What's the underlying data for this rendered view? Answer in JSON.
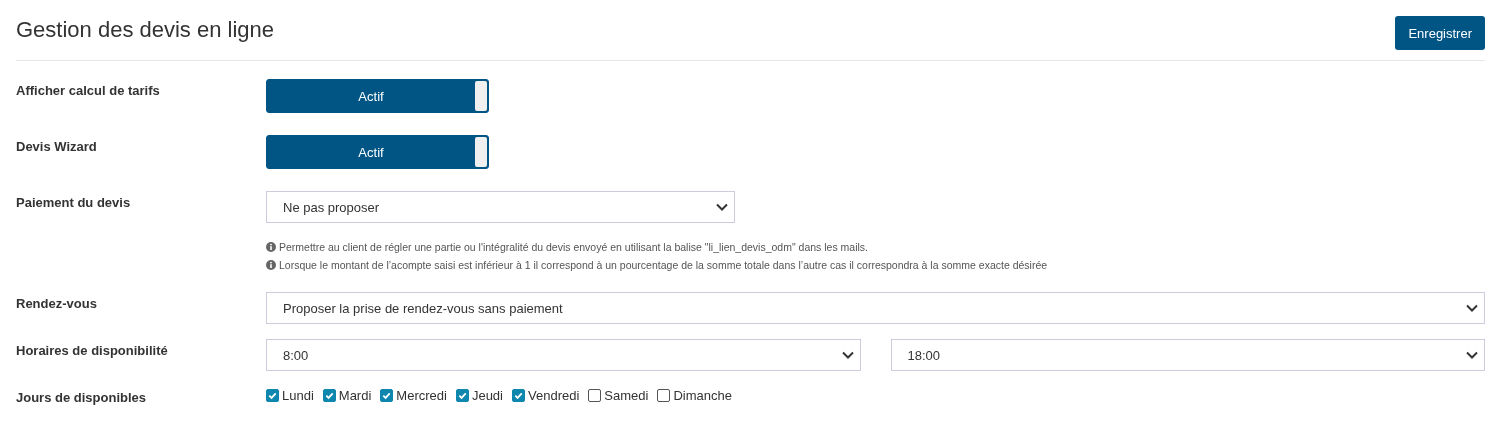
{
  "header": {
    "title": "Gestion des devis en ligne",
    "save_button": "Enregistrer"
  },
  "fields": [
    {
      "kind": "toggle",
      "label": "Afficher calcul de tarifs",
      "on": true,
      "state_text": "Actif"
    },
    {
      "kind": "toggle",
      "label": "Devis Wizard",
      "on": true,
      "state_text": "Actif"
    },
    {
      "kind": "short_select",
      "label": "Paiement du devis",
      "value": "Ne pas proposer",
      "notes": [
        "Permettre au client de régler une partie ou l'intégralité du devis envoyé en utilisant la balise \"li_lien_devis_odm\" dans les mails.",
        "Lorsque le montant de l’acompte saisi est inférieur à 1 il correspond à un pourcentage de la somme totale dans l’autre cas il correspondra à la somme exacte désirée"
      ]
    },
    {
      "kind": "select",
      "label": "Rendez-vous",
      "value": "Proposer la prise de rendez-vous sans paiement"
    },
    {
      "kind": "range",
      "label": "Horaires de disponibilité",
      "values": [
        "8:00",
        "18:00"
      ]
    },
    {
      "kind": "days",
      "label": "Jours de disponibles",
      "days": [
        {
          "label": "Lundi",
          "checked": true
        },
        {
          "label": "Mardi",
          "checked": true
        },
        {
          "label": "Mercredi",
          "checked": true
        },
        {
          "label": "Jeudi",
          "checked": true
        },
        {
          "label": "Vendredi",
          "checked": true
        },
        {
          "label": "Samedi",
          "checked": false
        },
        {
          "label": "Dimanche",
          "checked": false
        }
      ]
    }
  ]
}
